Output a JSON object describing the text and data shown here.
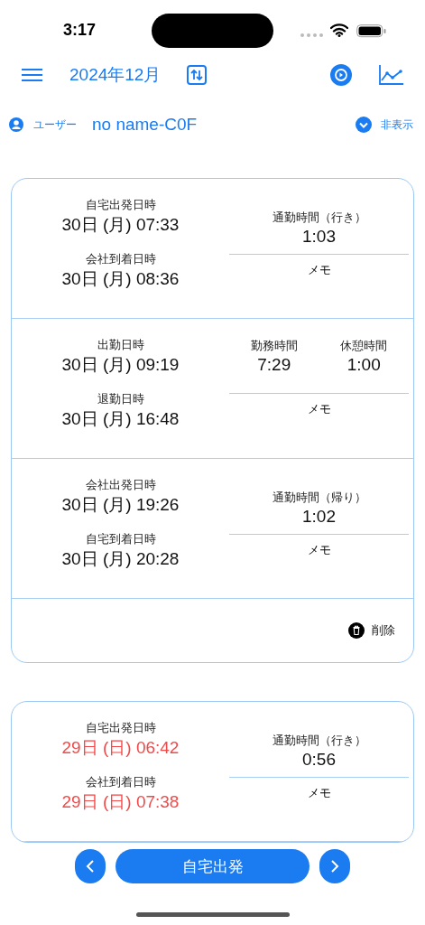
{
  "status_bar": {
    "time": "3:17"
  },
  "toolbar": {
    "title": "2024年12月"
  },
  "user": {
    "label": "ユーザー",
    "name": "no name-C0F",
    "toggle_label": "非表示"
  },
  "records": [
    {
      "weekend": false,
      "delete_label": "削除",
      "sections": [
        {
          "kind": "commute",
          "fields": [
            {
              "label": "自宅出発日時",
              "value": "30日 (月) 07:33"
            },
            {
              "label": "会社到着日時",
              "value": "30日 (月) 08:36"
            }
          ],
          "durations": [
            {
              "label": "通勤時間（行き）",
              "value": "1:03"
            }
          ],
          "memo_label": "メモ"
        },
        {
          "kind": "work",
          "fields": [
            {
              "label": "出勤日時",
              "value": "30日 (月) 09:19"
            },
            {
              "label": "退勤日時",
              "value": "30日 (月) 16:48"
            }
          ],
          "durations": [
            {
              "label": "勤務時間",
              "value": "7:29"
            },
            {
              "label": "休憩時間",
              "value": "1:00"
            }
          ],
          "memo_label": "メモ"
        },
        {
          "kind": "commute",
          "fields": [
            {
              "label": "会社出発日時",
              "value": "30日 (月) 19:26"
            },
            {
              "label": "自宅到着日時",
              "value": "30日 (月) 20:28"
            }
          ],
          "durations": [
            {
              "label": "通勤時間（帰り）",
              "value": "1:02"
            }
          ],
          "memo_label": "メモ"
        }
      ]
    },
    {
      "weekend": true,
      "sections": [
        {
          "kind": "commute",
          "fields": [
            {
              "label": "自宅出発日時",
              "value": "29日 (日) 06:42"
            },
            {
              "label": "会社到着日時",
              "value": "29日 (日) 07:38"
            }
          ],
          "durations": [
            {
              "label": "通勤時間（行き）",
              "value": "0:56"
            }
          ],
          "memo_label": "メモ"
        }
      ]
    }
  ],
  "bottom_bar": {
    "action": "自宅出発"
  }
}
